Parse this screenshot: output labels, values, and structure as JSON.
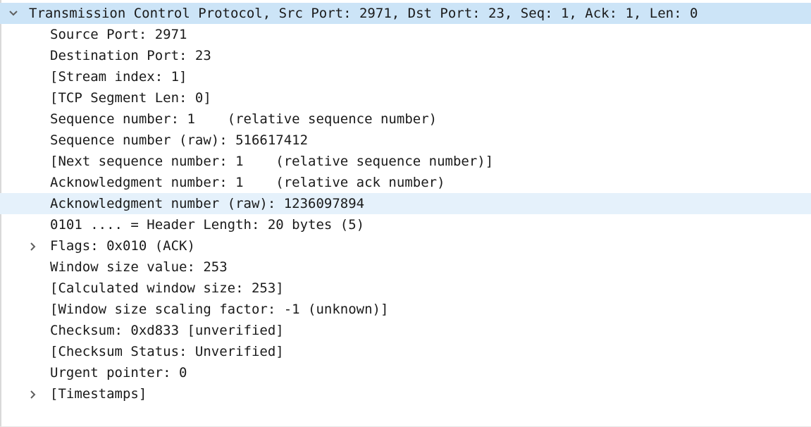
{
  "tree": {
    "header": {
      "label": "Transmission Control Protocol, Src Port: 2971, Dst Port: 23, Seq: 1, Ack: 1, Len: 0",
      "expanded": true,
      "selected": true
    },
    "fields": [
      {
        "label": "Source Port: 2971"
      },
      {
        "label": "Destination Port: 23"
      },
      {
        "label": "[Stream index: 1]"
      },
      {
        "label": "[TCP Segment Len: 0]"
      },
      {
        "label": "Sequence number: 1    (relative sequence number)"
      },
      {
        "label": "Sequence number (raw): 516617412"
      },
      {
        "label": "[Next sequence number: 1    (relative sequence number)]"
      },
      {
        "label": "Acknowledgment number: 1    (relative ack number)"
      },
      {
        "label": "Acknowledgment number (raw): 1236097894",
        "hovered": true
      },
      {
        "label": "0101 .... = Header Length: 20 bytes (5)"
      },
      {
        "label": "Flags: 0x010 (ACK)",
        "expandable": true,
        "expanded": false
      },
      {
        "label": "Window size value: 253"
      },
      {
        "label": "[Calculated window size: 253]"
      },
      {
        "label": "[Window size scaling factor: -1 (unknown)]"
      },
      {
        "label": "Checksum: 0xd833 [unverified]"
      },
      {
        "label": "[Checksum Status: Unverified]"
      },
      {
        "label": "Urgent pointer: 0"
      },
      {
        "label": "[Timestamps]",
        "expandable": true,
        "expanded": false
      }
    ]
  },
  "colors": {
    "selected_row": "#cce4f7",
    "hovered_row": "#e5f1fb",
    "text": "#1a1a1a",
    "expander": "#5f5f5f"
  },
  "icons": {
    "expanded": "chevron-down-icon",
    "collapsed": "chevron-right-icon"
  }
}
